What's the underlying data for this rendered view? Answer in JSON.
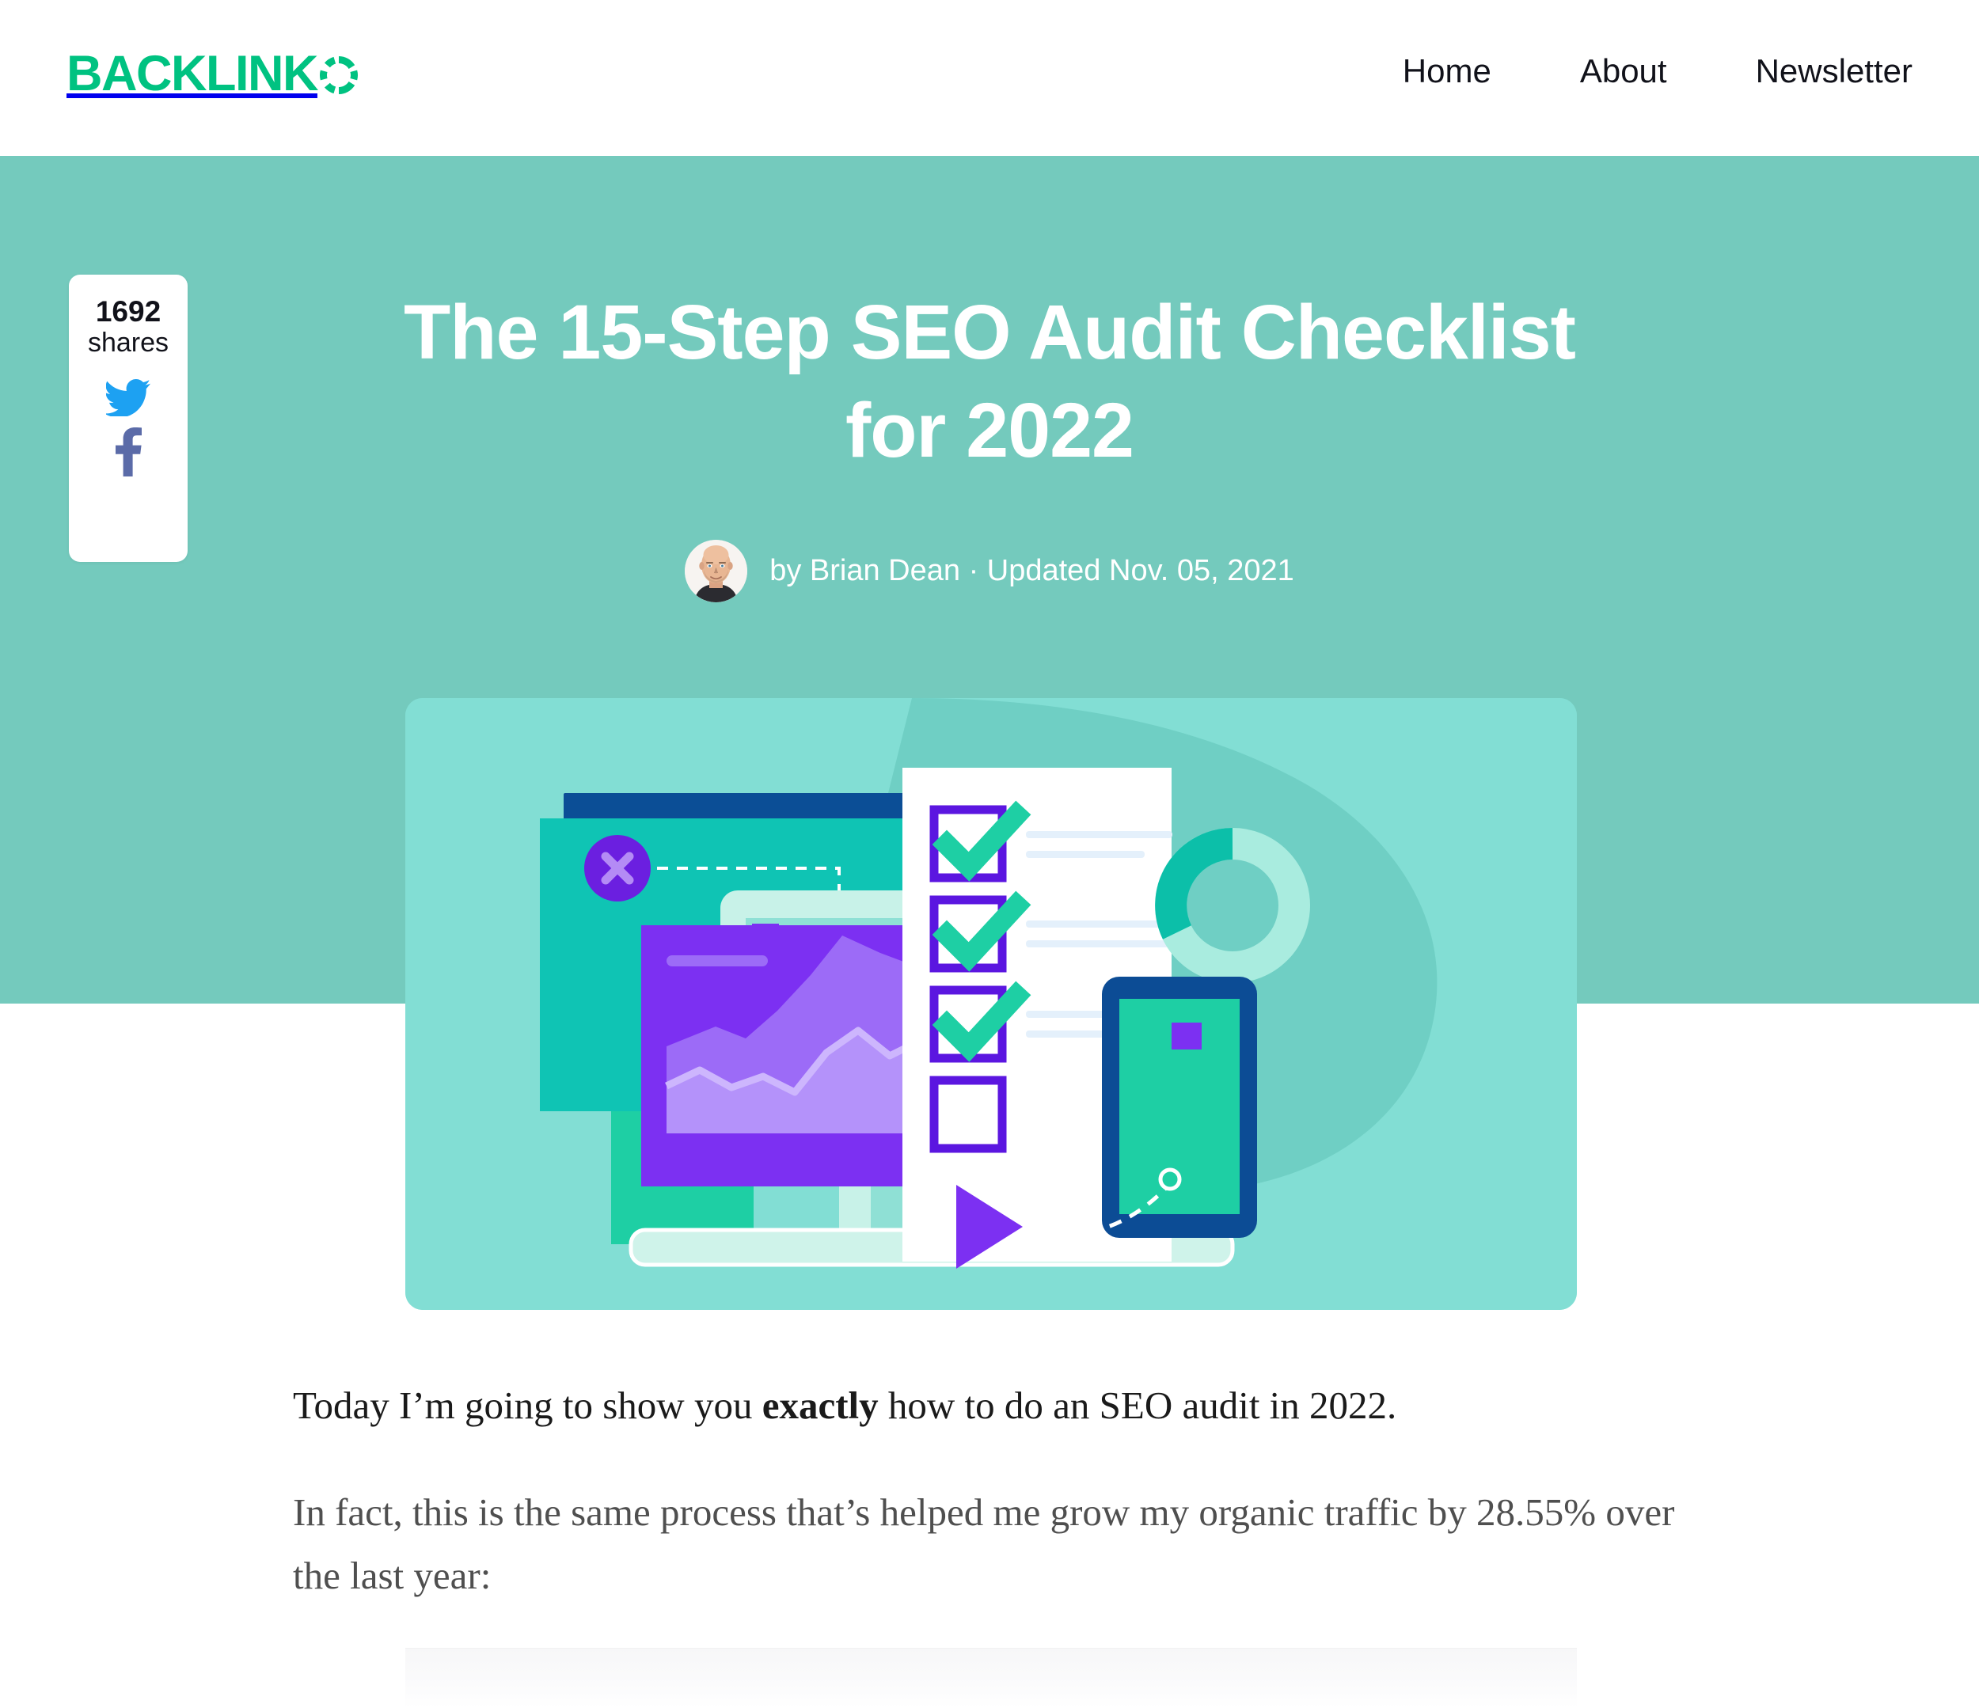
{
  "brand": {
    "logo_text": "BACKLINK",
    "logo_mark_icon": "segmented-ring-o-icon",
    "accent_green": "#00C281"
  },
  "nav": {
    "items": [
      {
        "label": "Home"
      },
      {
        "label": "About"
      },
      {
        "label": "Newsletter"
      }
    ]
  },
  "hero": {
    "band_color": "#74CABD",
    "title": "The 15-Step SEO Audit Checklist for 2022",
    "byline": "by Brian Dean · Updated Nov. 05, 2021",
    "avatar_icon": "author-avatar-photo",
    "illustration_alt": "SEO audit checklist illustration",
    "illustration_card_color": "#82DED4"
  },
  "share": {
    "count": "1692",
    "label": "shares",
    "twitter_icon": "twitter-bird-icon",
    "twitter_color": "#1DA1F2",
    "facebook_icon": "facebook-f-icon",
    "facebook_color": "#5B6BA8"
  },
  "article": {
    "paragraph_1_pre": "Today I’m going to show you ",
    "paragraph_1_bold": "exactly",
    "paragraph_1_post": " how to do an SEO audit in 2022.",
    "paragraph_2": "In fact, this is the same process that’s helped me grow my organic traffic by 28.55% over the last year:"
  },
  "illustration": {
    "colors": {
      "card_bg": "#82DED4",
      "blob_dark_teal": "#6FCFC4",
      "browser_window": "#0FC4B4",
      "browser_titlebar": "#0B4E96",
      "purple_circle": "#6B1FE0",
      "purple_x": "#B48BF5",
      "monitor_frame": "#C8F2E8",
      "monitor_screen": "#8FE0D5",
      "chart_panel": "#7C30F2",
      "chart_area_light": "#9C6BF7",
      "chart_area_lighter": "#B492FA",
      "chart_line": "#CDB6FD",
      "paper_white": "#FFFFFF",
      "checkbox_border": "#5B16E0",
      "check_mark": "#1ECFA4",
      "text_line": "#E4F0FB",
      "phone_frame": "#0C4C95",
      "phone_screen": "#1ECFA4",
      "donut_dark": "#0CBFA9",
      "donut_light": "#A9ECDF",
      "green_quarter": "#1ECFA4",
      "purple_square": "#7C30F2",
      "purple_triangle": "#7C30F2",
      "laptop_base": "#CFF3EA",
      "mouse_grey": "#DDE2EA"
    },
    "checklist": [
      {
        "checked": true
      },
      {
        "checked": true
      },
      {
        "checked": true
      },
      {
        "checked": false
      }
    ]
  }
}
